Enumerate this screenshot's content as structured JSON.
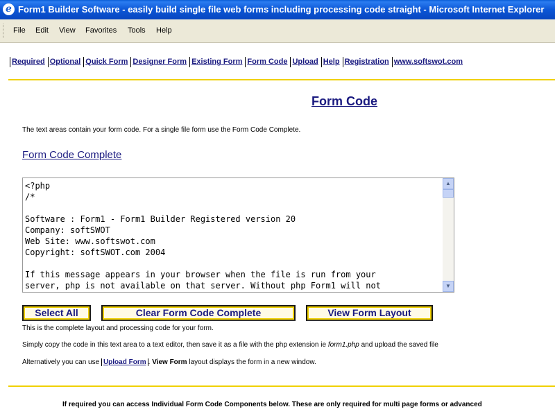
{
  "window": {
    "title": "Form1 Builder Software - easily build single file web forms including processing code straight  - Microsoft Internet Explorer"
  },
  "menu": {
    "file": "File",
    "edit": "Edit",
    "view": "View",
    "favorites": "Favorites",
    "tools": "Tools",
    "help": "Help"
  },
  "nav": {
    "items": [
      "Required",
      "Optional",
      "Quick Form",
      "Designer Form",
      "Existing Form",
      "Form Code",
      "Upload",
      "Help",
      "Registration",
      "www.softswot.com"
    ]
  },
  "page": {
    "title": "Form Code",
    "intro": "The text areas contain your form code. For a single file form use the Form Code Complete.",
    "section_title": "Form Code Complete",
    "code": "<?php\n/*\n\nSoftware : Form1 - Form1 Builder Registered version 20\nCompany: softSWOT\nWeb Site: www.softswot.com\nCopyright: softSWOT.com 2004\n\nIf this message appears in your browser when the file is run from your\nserver, php is not available on that server. Without php Form1 will not",
    "buttons": {
      "select_all": "Select All",
      "clear": "Clear Form Code Complete",
      "view_layout": "View Form Layout"
    },
    "line1": "This is the complete layout and processing code for your form.",
    "line2_pre": "Simply copy the code in this text area to a text editor, then save it as a file with the php extension ie ",
    "line2_file": "form1.php",
    "line2_post": " and upload the saved file",
    "line3_pre": "Alternatively you can use ",
    "line3_link": "Upload Form",
    "line3_mid": ". ",
    "line3_bold": "View Form",
    "line3_post": " layout displays the form in a new window.",
    "footer": "If required you can access Individual Form Code Components below. These are only required for multi page forms or advanced"
  }
}
